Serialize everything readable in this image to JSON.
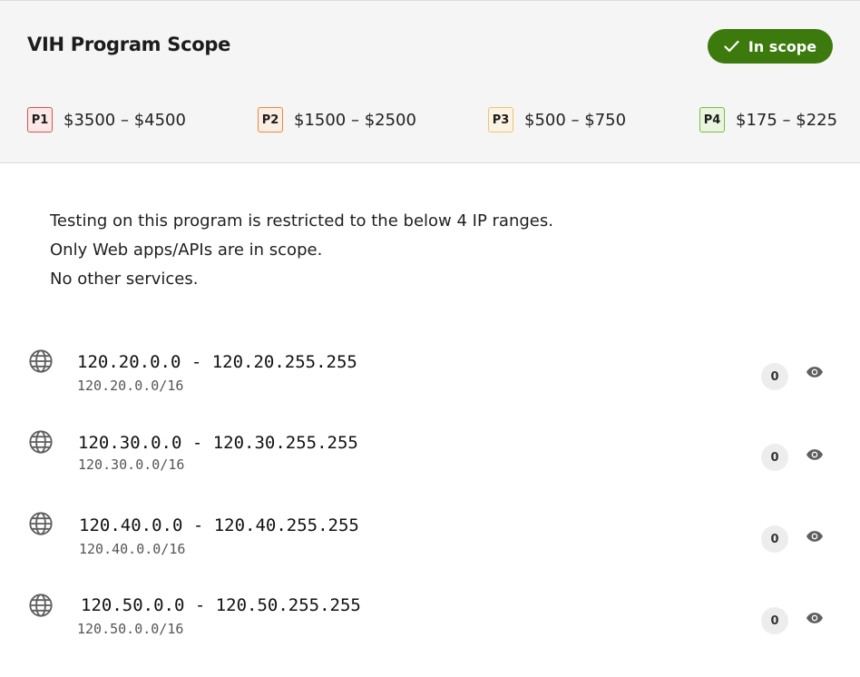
{
  "program": {
    "title": "VIH Program Scope",
    "status_badge": "In scope",
    "status_color": "#3c7a0d"
  },
  "rewards": [
    {
      "level": "P1",
      "range": "$3500 – $4500",
      "bg": "#fde8e8",
      "border": "#d9534f"
    },
    {
      "level": "P2",
      "range": "$1500 – $2500",
      "bg": "#fdeee2",
      "border": "#e8894a"
    },
    {
      "level": "P3",
      "range": "$500 – $750",
      "bg": "#fdf3e3",
      "border": "#f0c27a"
    },
    {
      "level": "P4",
      "range": "$175 – $225",
      "bg": "#e9f5df",
      "border": "#7cba4a"
    }
  ],
  "description": [
    "Testing on this program is restricted to the below 4 IP ranges.",
    "Only Web apps/APIs are in scope.",
    "No other services."
  ],
  "assets": [
    {
      "range": "120.20.0.0 - 120.20.255.255",
      "cidr": "120.20.0.0/16",
      "count": "0",
      "icon": "globe-icon"
    },
    {
      "range": "120.30.0.0 - 120.30.255.255",
      "cidr": "120.30.0.0/16",
      "count": "0",
      "icon": "globe-icon"
    },
    {
      "range": "120.40.0.0 - 120.40.255.255",
      "cidr": "120.40.0.0/16",
      "count": "0",
      "icon": "globe-icon"
    },
    {
      "range": "120.50.0.0 - 120.50.255.255",
      "cidr": "120.50.0.0/16",
      "count": "0",
      "icon": "globe-icon"
    }
  ]
}
